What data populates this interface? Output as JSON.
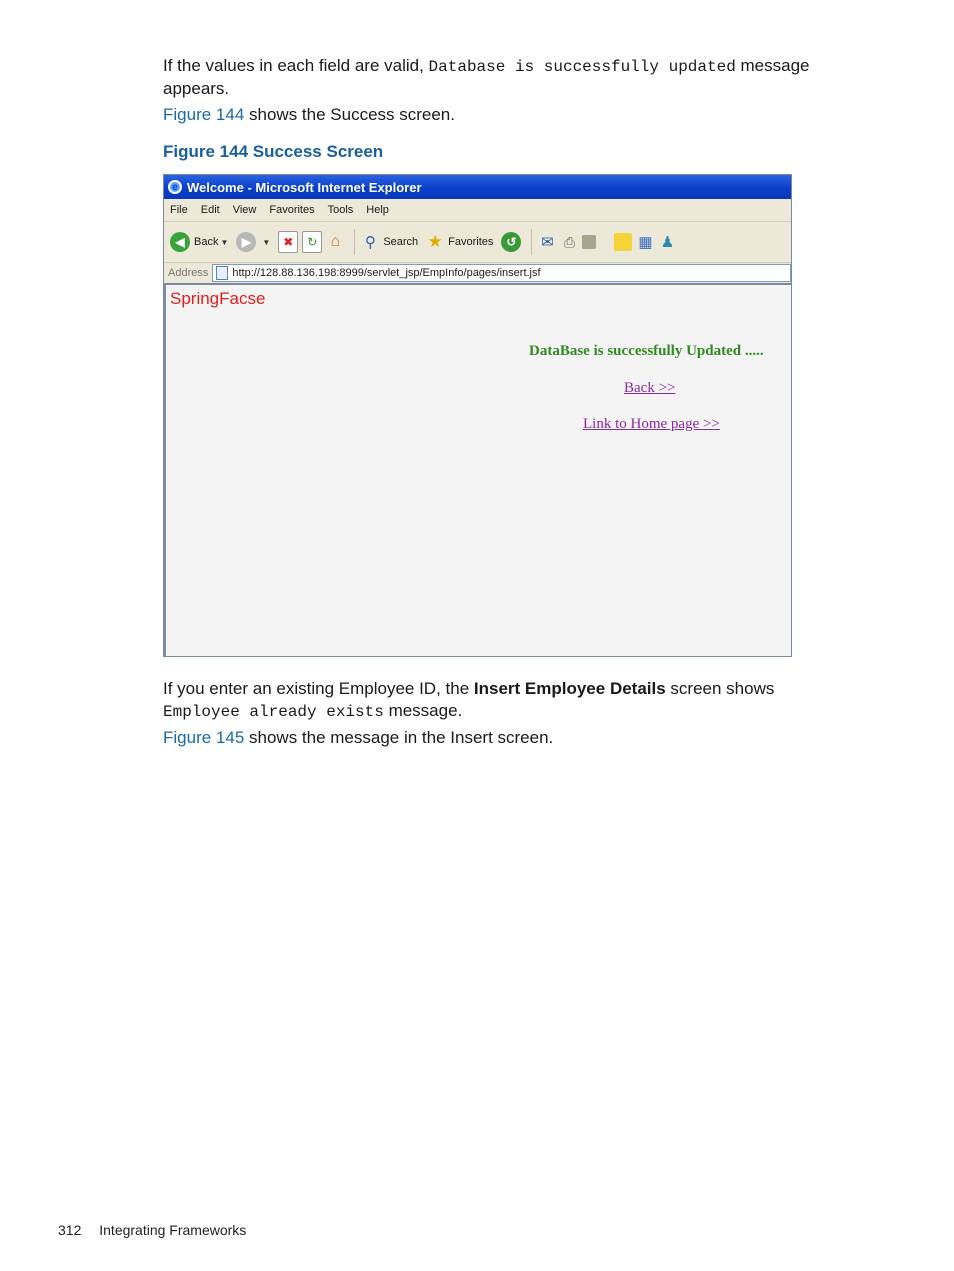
{
  "body": {
    "p1_text_a": "If the values in each field are valid, ",
    "p1_code": "Database is successfully updated",
    "p1_text_b": " message appears.",
    "p2_link": "Figure 144",
    "p2_text": " shows the Success screen.",
    "figure_caption": "Figure 144 Success Screen",
    "p3_text_a": "If you enter an existing Employee ID, the ",
    "p3_bold": "Insert Employee Details",
    "p3_text_b": " screen shows ",
    "p3_code": "Employee already exists",
    "p3_text_c": " message.",
    "p4_link": "Figure 145",
    "p4_text": " shows the message in the Insert screen."
  },
  "browser": {
    "title": "Welcome - Microsoft Internet Explorer",
    "menu": [
      "File",
      "Edit",
      "View",
      "Favorites",
      "Tools",
      "Help"
    ],
    "toolbar": {
      "back_label": "Back",
      "search_label": "Search",
      "favorites_label": "Favorites"
    },
    "address_label": "Address",
    "url": "http://128.88.136.198:8999/servlet_jsp/EmpInfo/pages/insert.jsf"
  },
  "page": {
    "brand": "SpringFacse",
    "success_message": "DataBase is successfully Updated .....",
    "back_link": "Back >>",
    "home_link": "Link to Home page >>"
  },
  "footer": {
    "page_number": "312",
    "section": "Integrating Frameworks"
  }
}
